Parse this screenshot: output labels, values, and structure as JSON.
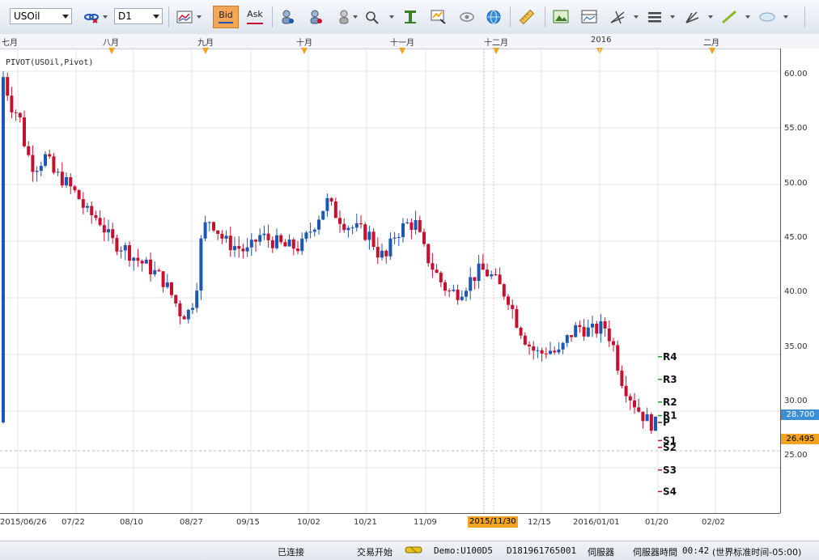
{
  "toolbar": {
    "symbol": "USOil",
    "timeframe": "D1",
    "bid_label": "Bid",
    "ask_label": "Ask",
    "icons": [
      "link-icon",
      "bar-chart-icon",
      "bid-button",
      "ask-button",
      "person-icon",
      "person-icon",
      "person-icon",
      "zoom-icon",
      "text-tool-icon",
      "signal-icon",
      "eye-icon",
      "globe-icon",
      "ruler-icon",
      "image-icon",
      "layout-icon",
      "fork-icon",
      "lines-icon",
      "pen-icon",
      "trend-line-icon",
      "ellipse-icon"
    ]
  },
  "months": [
    "七月",
    "八月",
    "九月",
    "十月",
    "十一月",
    "十二月",
    "2016",
    "二月"
  ],
  "indicator_label": "PIVOT(USOil,Pivot)",
  "price_axis": [
    "60.00",
    "55.00",
    "50.00",
    "45.00",
    "40.00",
    "35.00",
    "30.00",
    "25.00"
  ],
  "current_price": "28.700",
  "crosshair_price": "26.495",
  "date_axis": [
    "2015/06/26",
    "07/22",
    "08/10",
    "08/27",
    "09/15",
    "10/02",
    "10/21",
    "11/09",
    "2015/11/30",
    "12/15",
    "2016/01/01",
    "01/20",
    "02/02"
  ],
  "pivot_labels": [
    "R4",
    "R3",
    "R2",
    "R1",
    "P",
    "S1",
    "S2",
    "S3",
    "S4"
  ],
  "status": {
    "connection": "已连接",
    "trading": "交易开始",
    "account": "Demo:U100D5",
    "account_id": "D181961765001",
    "server": "伺服器",
    "server_time_label": "伺服器時間",
    "server_time": "00:42",
    "timezone": "(世界标准时间-05:00)"
  },
  "colors": {
    "up": "#1e56b4",
    "down": "#c8102e",
    "accent": "#f2a320",
    "price_tag": "#3a8fd8"
  },
  "chart_data": {
    "type": "candlestick",
    "symbol": "USOil",
    "timeframe": "D1",
    "ylim": [
      21,
      62
    ],
    "x": [
      "2015/06/26",
      "07/22",
      "08/10",
      "08/27",
      "09/15",
      "10/02",
      "10/21",
      "11/09",
      "2015/11/30",
      "12/15",
      "2016/01/01",
      "01/20"
    ],
    "close": [
      59.5,
      50.5,
      44.5,
      38.5,
      45.0,
      45.5,
      46.5,
      44.0,
      42.0,
      36.5,
      37.0,
      28.7
    ],
    "pivots": {
      "R4": 34.8,
      "R3": 32.8,
      "R2": 30.8,
      "R1": 29.6,
      "P": 29.0,
      "S1": 27.4,
      "S2": 26.8,
      "S3": 24.8,
      "S4": 22.9
    }
  }
}
